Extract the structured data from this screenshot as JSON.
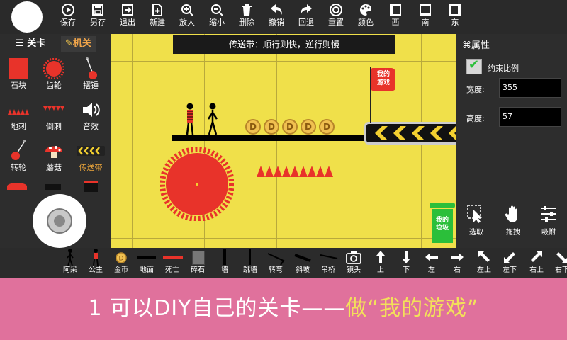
{
  "toolbar": {
    "items": [
      {
        "label": "保存",
        "icon": "play-icon"
      },
      {
        "label": "另存",
        "icon": "save-icon"
      },
      {
        "label": "退出",
        "icon": "exit-icon"
      },
      {
        "label": "新建",
        "icon": "new-icon"
      },
      {
        "label": "放大",
        "icon": "zoom-in-icon"
      },
      {
        "label": "缩小",
        "icon": "zoom-out-icon"
      },
      {
        "label": "删除",
        "icon": "trash-icon"
      },
      {
        "label": "撤销",
        "icon": "undo-icon"
      },
      {
        "label": "回退",
        "icon": "redo-icon"
      },
      {
        "label": "重置",
        "icon": "reset-icon"
      },
      {
        "label": "颜色",
        "icon": "palette-icon"
      },
      {
        "label": "西",
        "icon": "west-icon"
      },
      {
        "label": "南",
        "icon": "south-icon"
      },
      {
        "label": "东",
        "icon": "east-icon"
      }
    ]
  },
  "left_panel": {
    "tabs": [
      "关卡",
      "机关"
    ],
    "items": [
      "石块",
      "齿轮",
      "摆锤",
      "地刺",
      "倒刺",
      "音效",
      "转轮",
      "蘑菇",
      "传送带"
    ]
  },
  "canvas": {
    "hint": "传送带：顺行则快，逆行则慢",
    "flag_text": "我的\n游戏",
    "bin_text": "我的\n垃圾",
    "coin_symbol": "D",
    "coin_count": 5
  },
  "right_panel": {
    "title": "属性",
    "lock_ratio_label": "约束比例",
    "lock_ratio_checked": true,
    "width_label": "宽度:",
    "width_value": "355",
    "height_label": "高度:",
    "height_value": "57",
    "tools": [
      "选取",
      "拖拽",
      "吸附"
    ]
  },
  "bottom_bar": {
    "items": [
      "阿呆",
      "公主",
      "金币",
      "地面",
      "死亡",
      "碎石",
      "墙",
      "跳墙",
      "转弯",
      "斜坡",
      "吊桥",
      "镜头",
      "上",
      "下",
      "左",
      "右",
      "左上",
      "左下",
      "右上",
      "右下"
    ]
  },
  "banner": {
    "text_white": "1 可以DIY自己的关卡——",
    "text_yellow": "做“我的游戏”"
  },
  "colors": {
    "canvas_bg": "#f0e04a",
    "accent_red": "#e8332a",
    "banner_bg": "#e0719c",
    "banner_highlight": "#f3e05a",
    "conveyor_tab": "#e8a33a"
  }
}
